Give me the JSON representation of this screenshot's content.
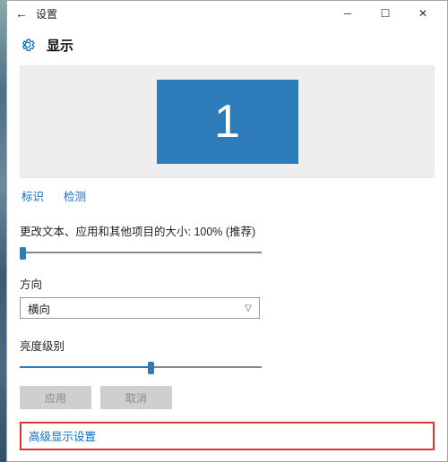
{
  "titlebar": {
    "app_name": "设置"
  },
  "header": {
    "page_title": "显示"
  },
  "monitor": {
    "number": "1"
  },
  "links": {
    "identify": "标识",
    "detect": "检测"
  },
  "scale": {
    "label": "更改文本、应用和其他项目的大小: 100% (推荐)"
  },
  "orientation": {
    "label": "方向",
    "value": "横向"
  },
  "brightness": {
    "label": "亮度级别"
  },
  "buttons": {
    "apply": "应用",
    "cancel": "取消"
  },
  "advanced": {
    "label": "高级显示设置"
  }
}
